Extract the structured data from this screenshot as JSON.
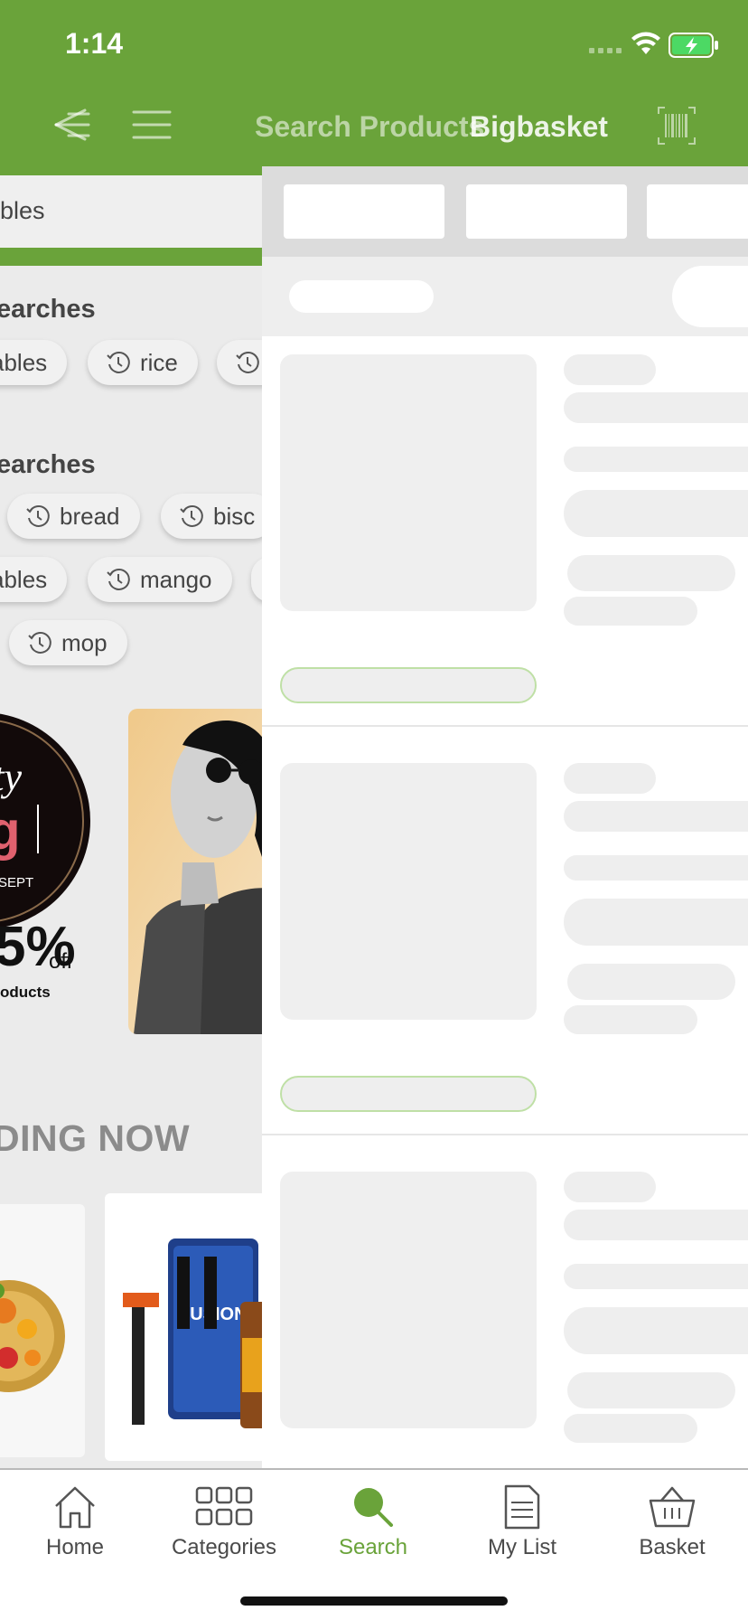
{
  "status_bar": {
    "time": "1:14"
  },
  "header": {
    "search_placeholder": "Search Products",
    "title": "Bigbasket",
    "icons": [
      "back-menu-icon",
      "hamburger-menu-icon",
      "barcode-scan-icon"
    ]
  },
  "left_screen": {
    "search_text": "bles",
    "recent_title": "earches",
    "recent_chips": [
      "ables",
      "rice",
      ""
    ],
    "popular_title": "earches",
    "popular_chips_row1": [
      "bread",
      "bisc"
    ],
    "popular_chips_row2": [
      "ables",
      "mango"
    ],
    "popular_chips_row3": [
      "mop"
    ],
    "banner": {
      "text_top": "tty",
      "text_mid": "g",
      "date": "SEPT",
      "percent": "5%",
      "off": "off",
      "products": "oducts"
    },
    "trending_title": "DING NOW"
  },
  "loading_panel": {
    "filters": 3,
    "product_skeletons": 3
  },
  "tabbar": {
    "tabs": [
      {
        "label": "Home",
        "icon": "home-icon"
      },
      {
        "label": "Categories",
        "icon": "categories-grid-icon"
      },
      {
        "label": "Search",
        "icon": "search-icon",
        "active": true
      },
      {
        "label": "My List",
        "icon": "list-document-icon"
      },
      {
        "label": "Basket",
        "icon": "basket-icon"
      }
    ]
  },
  "colors": {
    "brand_green": "#6aa33a",
    "skeleton": "#eeeeee",
    "text_dark": "#444444"
  }
}
